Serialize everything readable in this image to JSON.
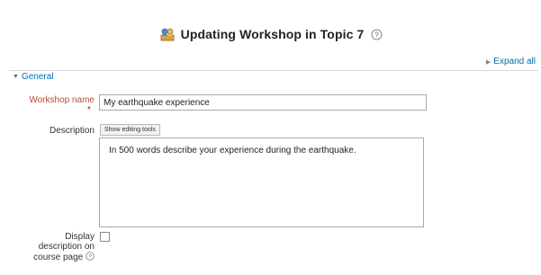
{
  "header": {
    "title": "Updating Workshop in Topic 7"
  },
  "toolbar": {
    "expand_all": "Expand all"
  },
  "section": {
    "general": "General"
  },
  "form": {
    "workshop_name_label": "Workshop name",
    "workshop_name_value": "My earthquake experience",
    "description_label": "Description",
    "show_editing_tools": "Show editing tools",
    "description_text": "In 500 words describe your experience during the earthquake.",
    "display_description_line1": "Display",
    "display_description_line2": "description on",
    "display_description_line3": "course page",
    "display_description_checked": false
  },
  "icons": {
    "module": "workshop-module-icon",
    "help": "help-icon",
    "expand": "triangle-right-icon",
    "collapse": "triangle-down-icon"
  },
  "colors": {
    "link": "#0070a8",
    "required_label": "#b94a2a",
    "required_star": "#cc0000"
  }
}
